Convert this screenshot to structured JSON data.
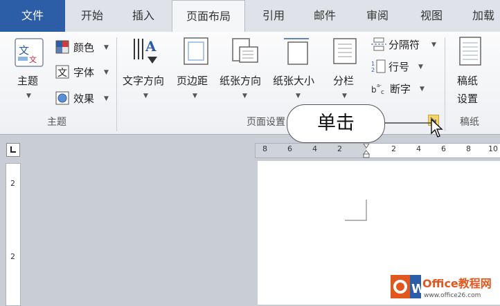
{
  "tabs": [
    {
      "label": "文件"
    },
    {
      "label": "开始"
    },
    {
      "label": "插入"
    },
    {
      "label": "页面布局"
    },
    {
      "label": "引用"
    },
    {
      "label": "邮件"
    },
    {
      "label": "审阅"
    },
    {
      "label": "视图"
    },
    {
      "label": "加载"
    }
  ],
  "theme_group": {
    "theme_label": "主题",
    "colors_label": "颜色",
    "fonts_label": "字体",
    "effects_label": "效果",
    "group_name": "主题"
  },
  "page_setup_group": {
    "text_direction": "文字方向",
    "margins": "页边距",
    "orientation": "纸张方向",
    "size": "纸张大小",
    "columns": "分栏",
    "breaks": "分隔符",
    "line_numbers": "行号",
    "hyphenation": "断字",
    "group_name": "页面设置"
  },
  "draft_group": {
    "button_line1": "稿纸",
    "button_line2": "设置",
    "group_name": "稿纸"
  },
  "ruler": {
    "numbers": [
      "8",
      "6",
      "4",
      "2",
      "2",
      "4",
      "6",
      "8",
      "10"
    ]
  },
  "vertical_ruler": {
    "numbers": [
      "2",
      "2"
    ]
  },
  "callout": {
    "text": "单击"
  },
  "watermark": {
    "brand": "Office教程网",
    "url": "www.office26.com",
    "letter": "W"
  },
  "colors": {
    "file_tab": "#2c5ea8",
    "launcher": "#f3d46a",
    "accent_orange": "#e2571e"
  }
}
